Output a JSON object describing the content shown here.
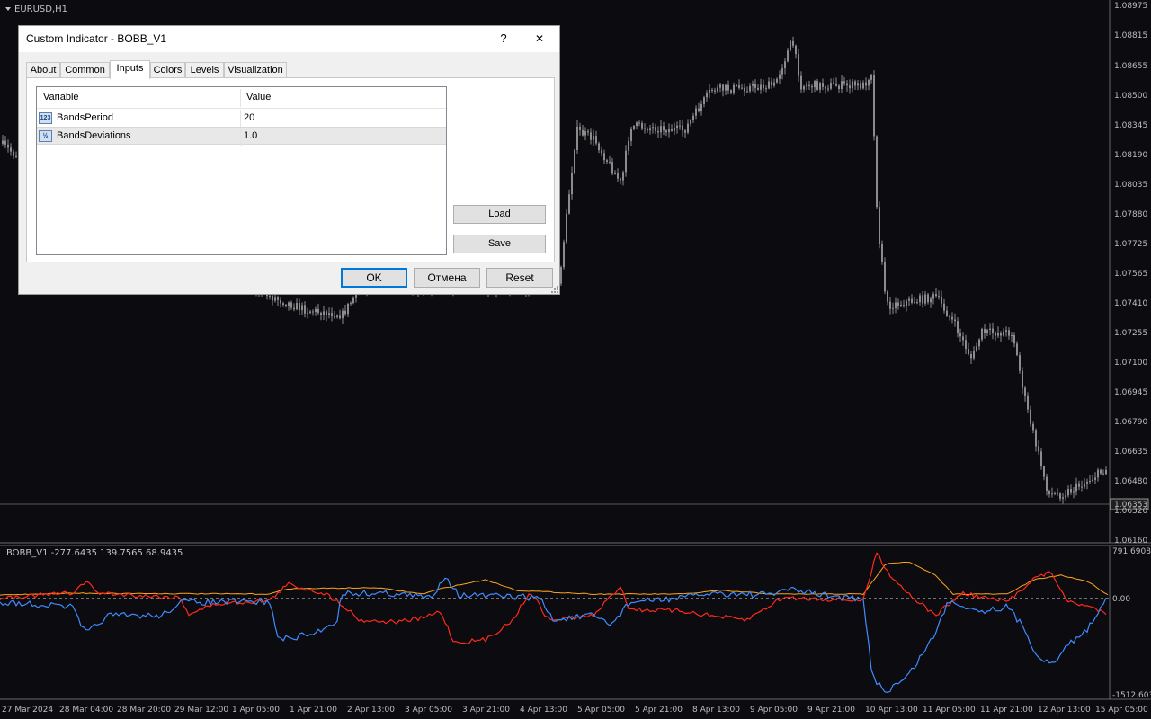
{
  "chart": {
    "symbol_label": "EURUSD,H1",
    "current_price": "1.06353",
    "price_ticks": [
      "1.08975",
      "1.08815",
      "1.08655",
      "1.08500",
      "1.08345",
      "1.08190",
      "1.08035",
      "1.07880",
      "1.07725",
      "1.07565",
      "1.07410",
      "1.07255",
      "1.07100",
      "1.06945",
      "1.06790",
      "1.06635",
      "1.06480",
      "1.06320",
      "1.06160"
    ],
    "indicator_label": "BOBB_V1 -277.6435 139.7565 68.9435",
    "indicator_ticks": [
      "791.6908",
      "0.00",
      "-1512.603"
    ],
    "time_ticks": [
      "27 Mar 2024",
      "28 Mar 04:00",
      "28 Mar 20:00",
      "29 Mar 12:00",
      "1 Apr 05:00",
      "1 Apr 21:00",
      "2 Apr 13:00",
      "3 Apr 05:00",
      "3 Apr 21:00",
      "4 Apr 13:00",
      "5 Apr 05:00",
      "5 Apr 21:00",
      "8 Apr 13:00",
      "9 Apr 05:00",
      "9 Apr 21:00",
      "10 Apr 13:00",
      "11 Apr 05:00",
      "11 Apr 21:00",
      "12 Apr 13:00",
      "15 Apr 05:00"
    ],
    "colors": {
      "background": "#0b0b10",
      "candle": "#8c8c8c",
      "grid_line": "#5a5a5a",
      "indicator_red": "#ff2a1a",
      "indicator_blue": "#3f8cff",
      "indicator_orange": "#ffa51c",
      "zero_line": "#d8d8d8"
    }
  },
  "dialog": {
    "title": "Custom Indicator - BOBB_V1",
    "help_label": "?",
    "close_label": "✕",
    "tabs": [
      "About",
      "Common",
      "Inputs",
      "Colors",
      "Levels",
      "Visualization"
    ],
    "active_tab": "Inputs",
    "table": {
      "headers": [
        "Variable",
        "Value"
      ],
      "rows": [
        {
          "icon": "123",
          "name": "BandsPeriod",
          "value": "20"
        },
        {
          "icon": "½",
          "name": "BandsDeviations",
          "value": "1.0"
        }
      ]
    },
    "buttons": {
      "load": "Load",
      "save": "Save",
      "ok": "OK",
      "cancel": "Отмена",
      "reset": "Reset"
    }
  }
}
